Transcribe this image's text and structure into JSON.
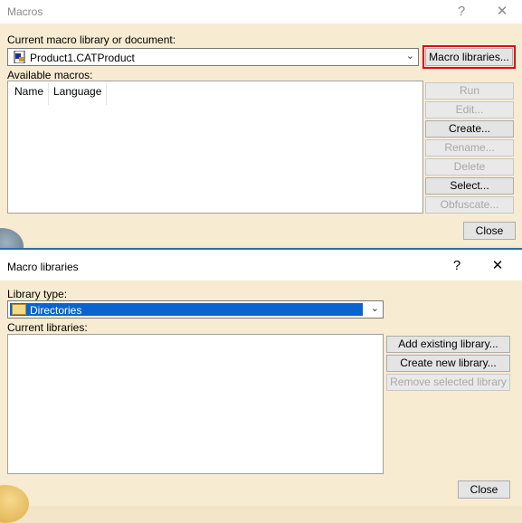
{
  "macros_dialog": {
    "title": "Macros",
    "help_glyph": "?",
    "close_glyph": "✕",
    "current_label": "Current macro library or document:",
    "current_value": "Product1.CATProduct",
    "macro_libraries_button": "Macro libraries...",
    "available_label": "Available macros:",
    "columns": [
      "Name",
      "Language"
    ],
    "buttons": {
      "run": "Run",
      "edit": "Edit...",
      "create": "Create...",
      "rename": "Rename...",
      "delete": "Delete",
      "select": "Select...",
      "obfuscate": "Obfuscate..."
    },
    "close_button": "Close"
  },
  "libraries_dialog": {
    "title": "Macro libraries",
    "help_glyph": "?",
    "close_glyph": "✕",
    "library_type_label": "Library type:",
    "library_type_value": "Directories",
    "current_libraries_label": "Current libraries:",
    "buttons": {
      "add_existing": "Add existing library...",
      "create_new": "Create new library...",
      "remove_selected": "Remove selected library"
    },
    "close_button": "Close"
  },
  "colors": {
    "highlight_outline": "#e0001a",
    "selection": "#0a64d0"
  }
}
